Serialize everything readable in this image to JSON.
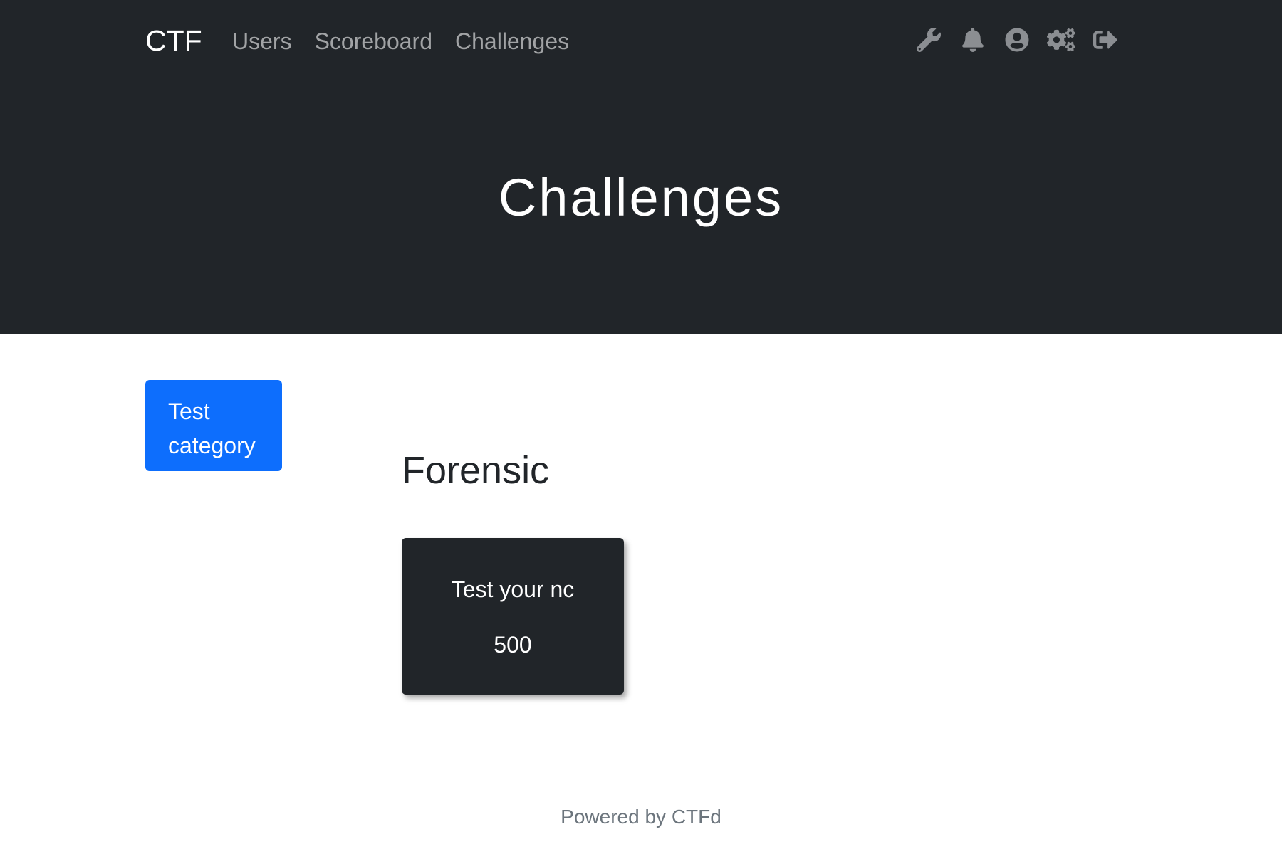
{
  "navbar": {
    "brand": "CTF",
    "links": [
      {
        "label": "Users"
      },
      {
        "label": "Scoreboard"
      },
      {
        "label": "Challenges"
      }
    ],
    "icons": [
      "wrench-icon",
      "bell-icon",
      "user-circle-icon",
      "cogs-icon",
      "sign-out-icon"
    ]
  },
  "jumbotron": {
    "title": "Challenges"
  },
  "categories": {
    "pill_label": "Test category"
  },
  "section": {
    "heading": "Forensic",
    "challenges": [
      {
        "name": "Test your nc",
        "value": "500"
      }
    ]
  },
  "footer": {
    "text": "Powered by CTFd"
  },
  "colors": {
    "navbar_bg": "#212529",
    "accent": "#0d6efd",
    "card_bg": "#212529",
    "muted_text": "#6c757d"
  }
}
